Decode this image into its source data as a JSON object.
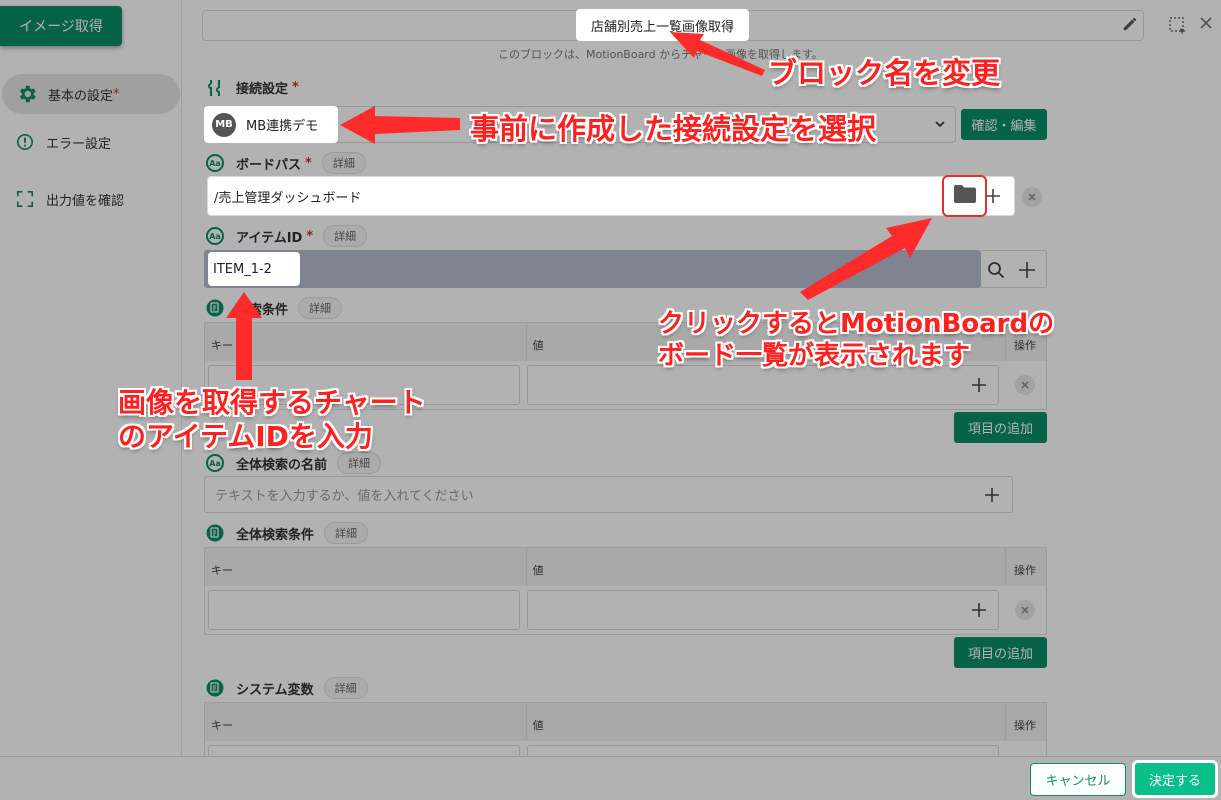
{
  "left_pane": {
    "image_button": "イメージ取得",
    "nav": [
      {
        "label": "基本の設定",
        "required": "*"
      },
      {
        "label": "エラー設定"
      },
      {
        "label": "出力値を確認"
      }
    ]
  },
  "header": {
    "block_name": "店舗別売上一覧画像取得",
    "description": "このブロックは、MotionBoard からチャート画像を取得します。"
  },
  "connection": {
    "label": "接続設定",
    "required": "*",
    "badge": "MB",
    "value": "MB連携デモ",
    "confirm_button": "確認・編集"
  },
  "board_path": {
    "label": "ボードパス",
    "required": "*",
    "detail": "詳細",
    "value": "/売上管理ダッシュボード"
  },
  "item_id": {
    "label": "アイテムID",
    "required": "*",
    "detail": "詳細",
    "value": "ITEM_1-2"
  },
  "search_conditions": {
    "label": "検索条件",
    "detail": "詳細",
    "columns": [
      "キー",
      "値",
      "操作"
    ],
    "add_button": "項目の追加"
  },
  "global_search_name": {
    "label": "全体検索の名前",
    "detail": "詳細",
    "placeholder": "テキストを入力するか、値を入れてください"
  },
  "global_search_conditions": {
    "label": "全体検索条件",
    "detail": "詳細",
    "columns": [
      "キー",
      "値",
      "操作"
    ],
    "add_button": "項目の追加"
  },
  "system_variables": {
    "label": "システム変数",
    "detail": "詳細",
    "columns": [
      "キー",
      "値",
      "操作"
    ]
  },
  "footer": {
    "cancel": "キャンセル",
    "ok": "決定する"
  },
  "annotations": {
    "rename_block": "ブロック名を変更",
    "select_connection": "事前に作成した接続設定を選択",
    "board_list_line1": "クリックするとMotionBoardの",
    "board_list_line2": "ボード一覧が表示されます",
    "item_id_line1": "画像を取得するチャート",
    "item_id_line2": "のアイテムIDを入力"
  },
  "colors": {
    "accent": "#0b8f67",
    "annotation": "#ff2020"
  }
}
